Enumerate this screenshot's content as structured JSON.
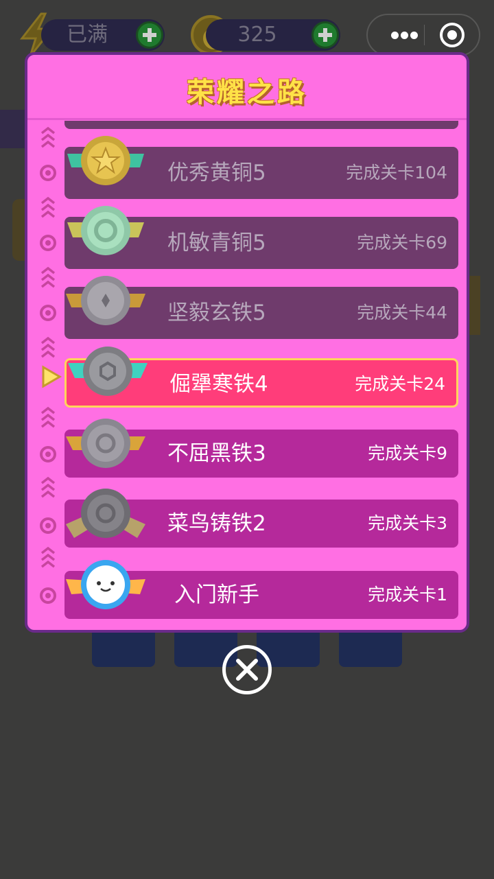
{
  "topbar": {
    "energy": {
      "value": "已满",
      "icon": "lightning-icon",
      "add_icon": "plus-icon"
    },
    "coins": {
      "value": "325",
      "icon": "coin-icon",
      "add_icon": "plus-icon"
    }
  },
  "capsule": {
    "more_icon": "more-dots-icon",
    "close_icon": "target-circle-icon"
  },
  "modal": {
    "title": "荣耀之路",
    "ranks": [
      {
        "name": "优秀黄铜5",
        "progress": "完成关卡104",
        "state": "locked",
        "medal": "gold-star-medal-icon",
        "marker": "dot"
      },
      {
        "name": "机敏青铜5",
        "progress": "完成关卡69",
        "state": "locked",
        "medal": "jade-ring-medal-icon",
        "marker": "dot"
      },
      {
        "name": "坚毅玄铁5",
        "progress": "完成关卡44",
        "state": "locked",
        "medal": "silver-diamond-medal-icon",
        "marker": "dot"
      },
      {
        "name": "倔犟寒铁4",
        "progress": "完成关卡24",
        "state": "current",
        "medal": "steel-hex-medal-icon",
        "marker": "pointer"
      },
      {
        "name": "不屈黑铁3",
        "progress": "完成关卡9",
        "state": "done",
        "medal": "gray-ring-medal-icon",
        "marker": "dot"
      },
      {
        "name": "菜鸟铸铁2",
        "progress": "完成关卡3",
        "state": "done",
        "medal": "dark-ring-medal-icon",
        "marker": "dot"
      },
      {
        "name": "入门新手",
        "progress": "完成关卡1",
        "state": "done",
        "medal": "smiley-medal-icon",
        "marker": "dot"
      }
    ]
  },
  "close_button": {
    "icon": "close-x-icon"
  },
  "colors": {
    "modal_bg": "#ff6fe3",
    "modal_border": "#6a2a8a",
    "row_locked": "#6f3b6c",
    "row_done": "#b5299b",
    "row_current": "#ff3d7a",
    "current_border": "#ffd55a",
    "title": "#ffe247"
  }
}
